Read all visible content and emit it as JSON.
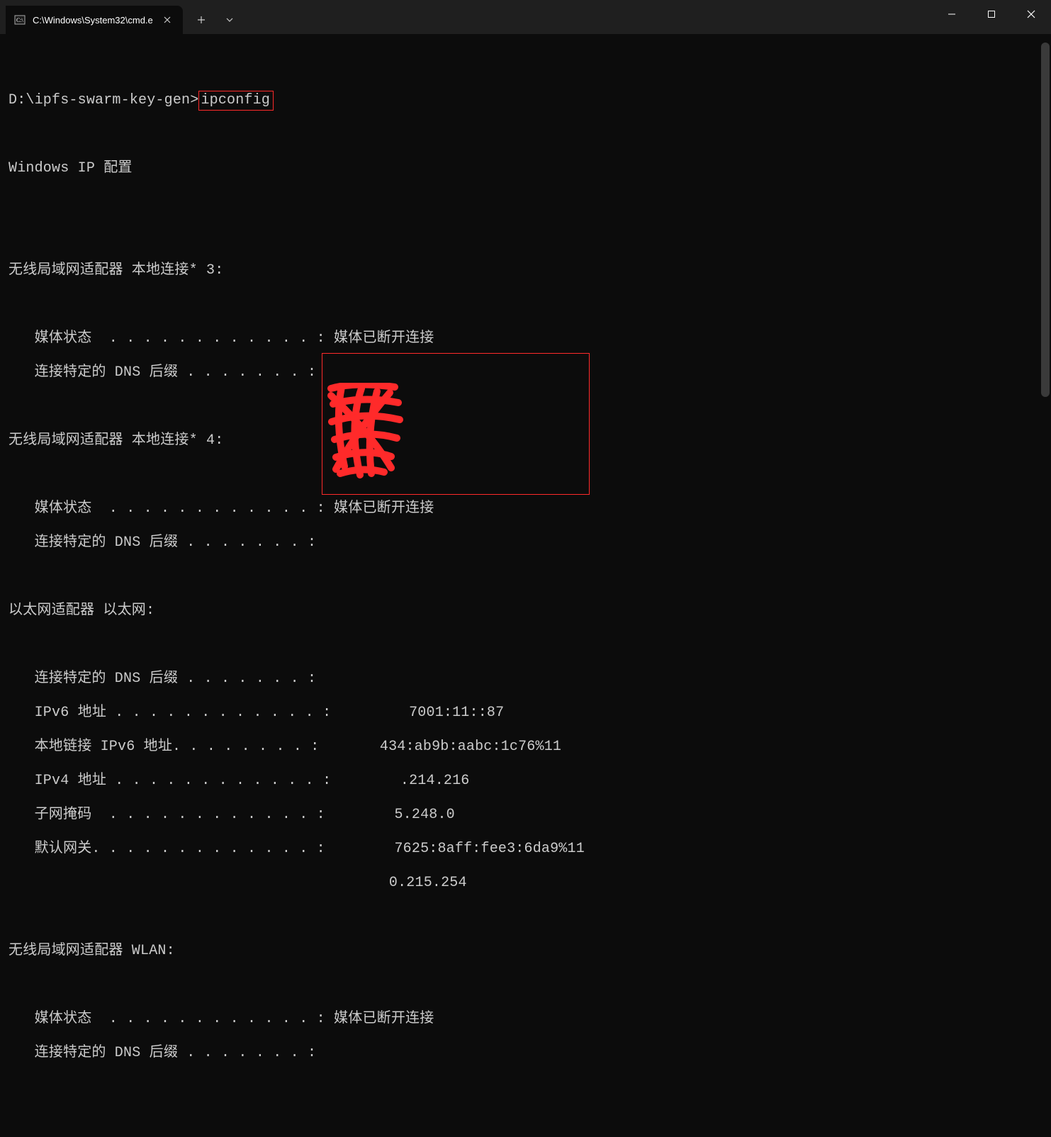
{
  "titlebar": {
    "tab_title": "C:\\Windows\\System32\\cmd.e",
    "new_tab_tooltip": "+",
    "dropdown_tooltip": "v"
  },
  "term": {
    "prompt": "D:\\ipfs-swarm-key-gen>",
    "command": "ipconfig",
    "header": "Windows IP 配置",
    "adapter3": {
      "title": "无线局域网适配器 本地连接* 3:",
      "media": "   媒体状态  . . . . . . . . . . . . : 媒体已断开连接",
      "dns": "   连接特定的 DNS 后缀 . . . . . . . :"
    },
    "adapter4": {
      "title": "无线局域网适配器 本地连接* 4:",
      "media": "   媒体状态  . . . . . . . . . . . . : 媒体已断开连接",
      "dns": "   连接特定的 DNS 后缀 . . . . . . . :"
    },
    "eth": {
      "title": "以太网适配器 以太网:",
      "dns": "   连接特定的 DNS 后缀 . . . . . . . :",
      "ipv6": "   IPv6 地址 . . . . . . . . . . . . :         7001:11::87",
      "llipv6": "   本地链接 IPv6 地址. . . . . . . . :       434:ab9b:aabc:1c76%11",
      "ipv4": "   IPv4 地址 . . . . . . . . . . . . :        .214.216",
      "mask": "   子网掩码  . . . . . . . . . . . . :        5.248.0",
      "gw1": "   默认网关. . . . . . . . . . . . . :        7625:8aff:fee3:6da9%11",
      "gw2": "                                            0.215.254"
    },
    "wlan": {
      "title": "无线局域网适配器 WLAN:",
      "media": "   媒体状态  . . . . . . . . . . . . : 媒体已断开连接",
      "dns": "   连接特定的 DNS 后缀 . . . . . . . :"
    }
  }
}
